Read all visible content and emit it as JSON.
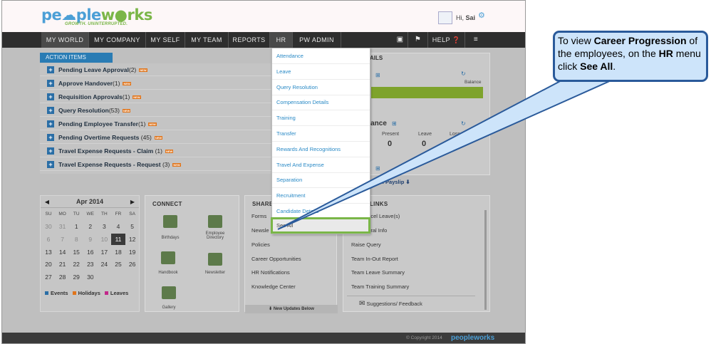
{
  "header": {
    "logo_part1": "pe",
    "logo_part2": "ple",
    "logo_part3": "w",
    "logo_part4": "rks",
    "tagline": "GROWTH. UNINTERRUPTED.",
    "greeting_prefix": "Hi,",
    "user_name": "Sai"
  },
  "nav": {
    "items": [
      "MY WORLD",
      "MY COMPANY",
      "MY SELF",
      "MY TEAM",
      "REPORTS",
      "HR",
      "PW ADMIN"
    ],
    "help": "HELP"
  },
  "action_items": {
    "tab_label": "ACTION ITEMS",
    "new_badge": "NEW",
    "items": [
      {
        "label": "Pending Leave Approval",
        "count": "(2)"
      },
      {
        "label": "Approve Handover",
        "count": "(1)"
      },
      {
        "label": "Requisition Approvals",
        "count": "(1)"
      },
      {
        "label": "Query Resolution",
        "count": "(53)"
      },
      {
        "label": "Pending Employee Transfer",
        "count": "(1)"
      },
      {
        "label": "Pending Overtime Requests",
        "count": " (45)"
      },
      {
        "label": "Travel Expense Requests - Claim",
        "count": " (1)"
      },
      {
        "label": "Travel Expense Requests - Request",
        "count": " (3)"
      }
    ]
  },
  "right_panel": {
    "title_fragment": "AILS",
    "balance": "Balance",
    "attendance_fragment": "dance",
    "present_label": "Present",
    "present_value": "0",
    "leave_label": "Leave",
    "leave_value": "0",
    "loss_label": "Loss of P",
    "payslip_fragment": "d uni",
    "payslip_label": "Payslip"
  },
  "calendar": {
    "month": "Apr 2014",
    "days_of_week": [
      "SU",
      "MO",
      "TU",
      "WE",
      "TH",
      "FR",
      "SA"
    ],
    "weeks": [
      [
        "30",
        "31",
        "1",
        "2",
        "3",
        "4",
        "5"
      ],
      [
        "6",
        "7",
        "8",
        "9",
        "10",
        "11",
        "12"
      ],
      [
        "13",
        "14",
        "15",
        "16",
        "17",
        "18",
        "19"
      ],
      [
        "20",
        "21",
        "22",
        "23",
        "24",
        "25",
        "26"
      ],
      [
        "27",
        "28",
        "29",
        "30",
        "",
        "",
        ""
      ]
    ],
    "today": "11",
    "legend": [
      {
        "label": "Events",
        "color": "#2a6ea6"
      },
      {
        "label": "Holidays",
        "color": "#e0751c"
      },
      {
        "label": "Leaves",
        "color": "#c2288a"
      }
    ]
  },
  "connect": {
    "title": "CONNECT",
    "items": [
      "Birthdays",
      "Employee Directory",
      "Handbook",
      "Newsletter",
      "Gallery"
    ]
  },
  "shared": {
    "title_fragment": "SHARE",
    "items": [
      "Forms",
      "Newsle",
      "Policies",
      "Career Opportunities",
      "HR Notifications",
      "Knowledge Center"
    ],
    "new_updates": "New Updates Below"
  },
  "links": {
    "title_fragment": "LINKS",
    "items": [
      "ancel Leave(s)",
      "neral Info",
      "Raise Query",
      "Team In-Out Report",
      "Team Leave Summary",
      "Team Training Summary"
    ],
    "feedback": "Suggestions/ Feedback"
  },
  "hr_menu": {
    "items": [
      "Attendance",
      "Leave",
      "Query Resolution",
      "Compensation Details",
      "Training",
      "Transfer",
      "Rewards And Recognitions",
      "Travel And Expense",
      "Separation",
      "Recruitment",
      "Candidate Details"
    ],
    "see_all": "See All"
  },
  "footer": {
    "copyright": "© Copyright 2014",
    "logo": "peopleworks"
  },
  "callout": {
    "t1": "To view ",
    "b1": "Career Progression",
    "t2": " of the employees, on the ",
    "b2": "HR",
    "t3": " menu click ",
    "b3": "See All",
    "t4": "."
  },
  "colors": {
    "nav_bg": "#2e2e2e",
    "accent_blue": "#2a7cb4",
    "accent_green": "#7ab648",
    "callout_bg": "#cde4fa",
    "callout_border": "#2a5a9a"
  }
}
